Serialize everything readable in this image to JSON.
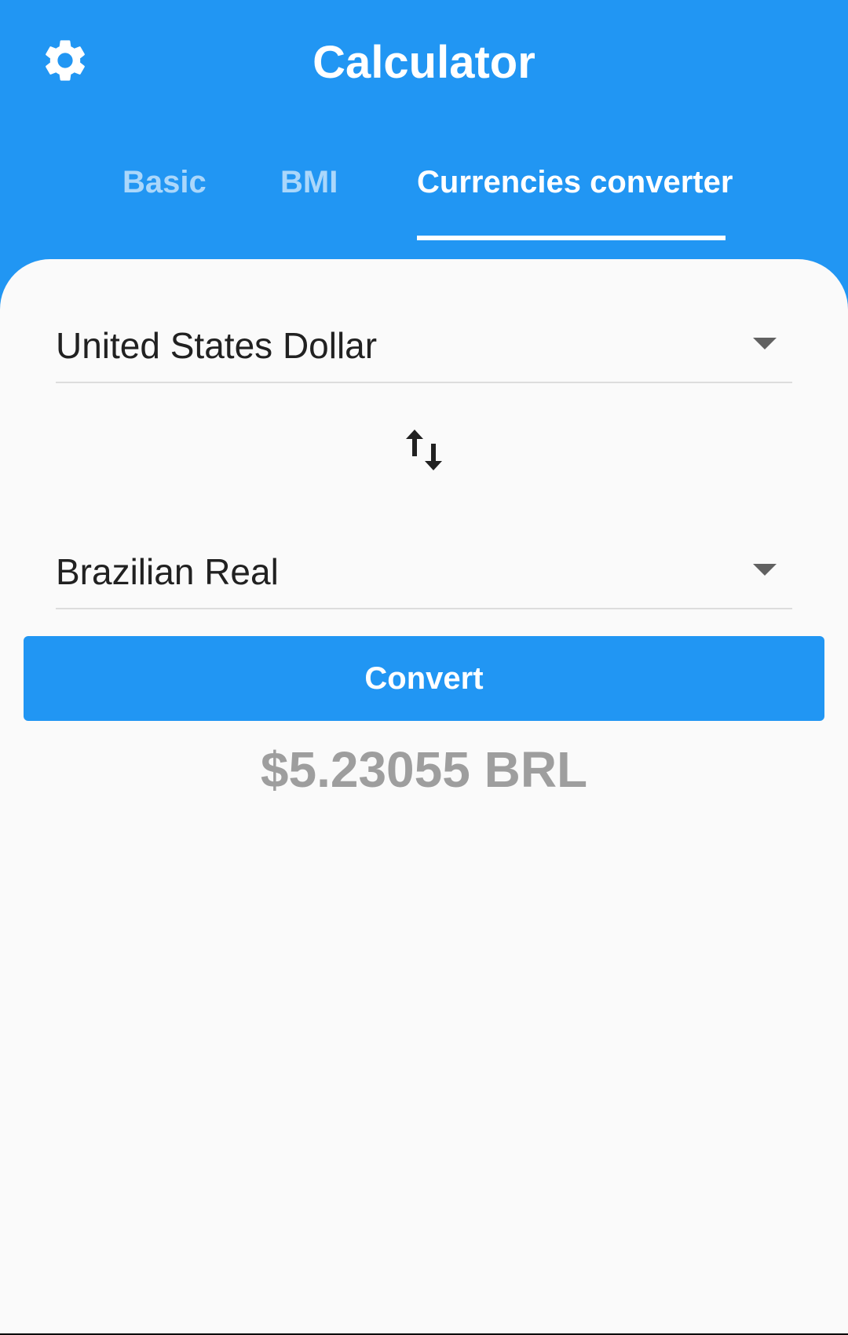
{
  "app": {
    "title": "Calculator"
  },
  "header": {
    "settings_icon": "gear-icon"
  },
  "tabs": [
    {
      "label": "Basic",
      "active": false
    },
    {
      "label": "BMI",
      "active": false
    },
    {
      "label": "Currencies converter",
      "active": true
    }
  ],
  "converter": {
    "from_currency": "United States Dollar",
    "to_currency": "Brazilian Real",
    "swap_icon": "swap-vertical-icon",
    "convert_label": "Convert",
    "result": "$5.23055 BRL"
  },
  "colors": {
    "primary": "#2196f3",
    "background": "#fafafa",
    "result_text": "#9e9e9e",
    "tab_inactive": "rgba(255,255,255,0.62)"
  }
}
